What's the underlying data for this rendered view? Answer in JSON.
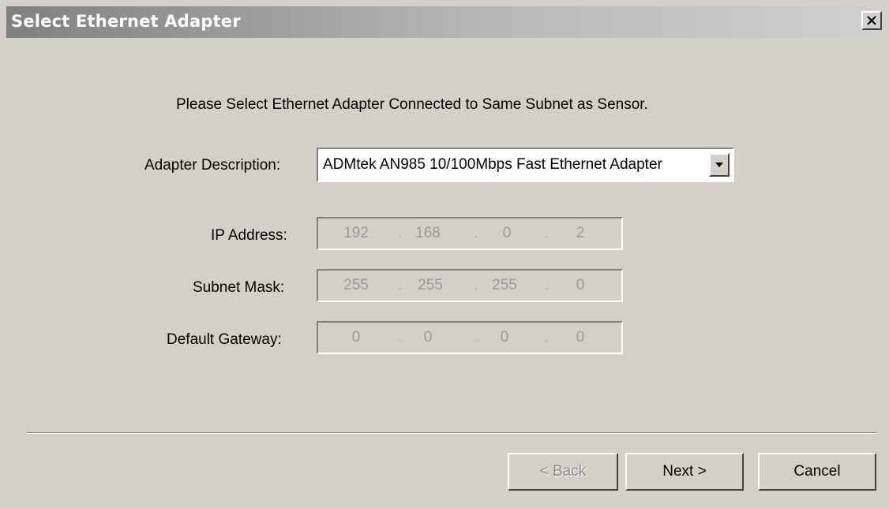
{
  "window": {
    "title": "Select Ethernet Adapter",
    "close_icon": "close-icon"
  },
  "prompt": "Please Select Ethernet Adapter Connected to Same Subnet as Sensor.",
  "adapter": {
    "label": "Adapter Description:",
    "selected": "ADMtek AN985 10/100Mbps Fast Ethernet Adapter"
  },
  "ip_address": {
    "label": "IP Address:",
    "octets": [
      "192",
      "168",
      "0",
      "2"
    ]
  },
  "subnet_mask": {
    "label": "Subnet Mask:",
    "octets": [
      "255",
      "255",
      "255",
      "0"
    ]
  },
  "default_gateway": {
    "label": "Default Gateway:",
    "octets": [
      "0",
      "0",
      "0",
      "0"
    ]
  },
  "buttons": {
    "back": "< Back",
    "next": "Next >",
    "cancel": "Cancel"
  }
}
